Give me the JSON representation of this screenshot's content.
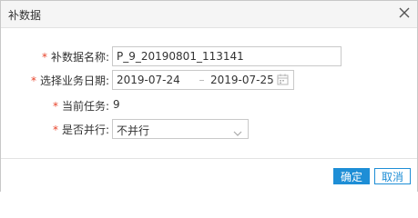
{
  "dialog": {
    "title": "补数据",
    "close_icon": "close-icon"
  },
  "form": {
    "name": {
      "required_mark": "*",
      "label": "补数据名称:",
      "value": "P_9_20190801_113141"
    },
    "date": {
      "required_mark": "*",
      "label": "选择业务日期:",
      "start": "2019-07-24",
      "end": "2019-07-25",
      "icon": "calendar-icon"
    },
    "tasks": {
      "required_mark": "*",
      "label": "当前任务:",
      "value": "9"
    },
    "parallel": {
      "required_mark": "*",
      "label": "是否并行:",
      "selected": "不并行",
      "icon": "chevron-down-icon"
    }
  },
  "footer": {
    "confirm_label": "确定",
    "cancel_label": "取消"
  },
  "colors": {
    "primary": "#1e8ed6",
    "required": "#e8442b",
    "border": "#c9c9c9"
  }
}
